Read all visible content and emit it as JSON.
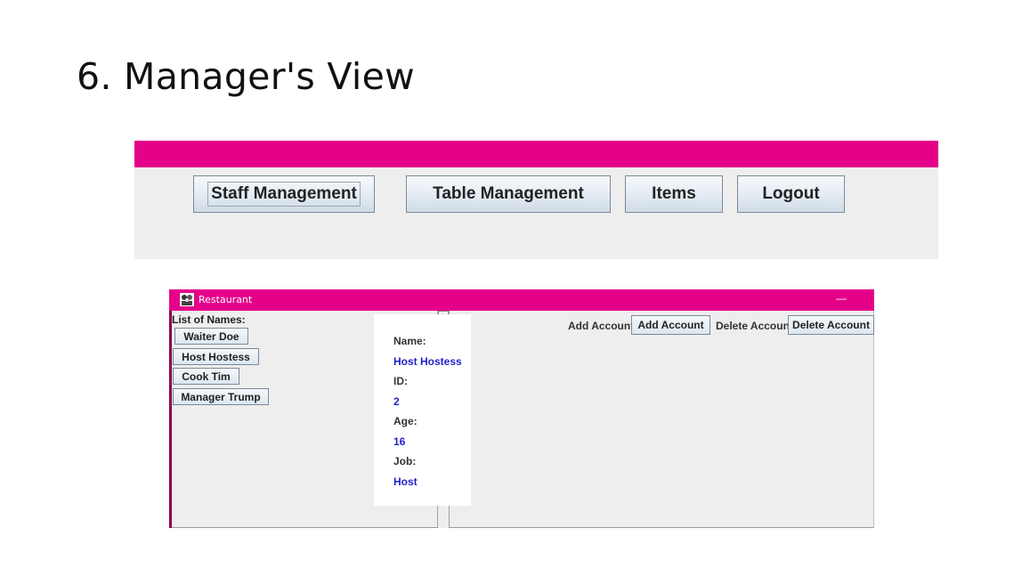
{
  "slide": {
    "title": "6.  Manager's View"
  },
  "colors": {
    "accent": "#e5008a",
    "value_text": "#1f1fc8"
  },
  "menu": {
    "buttons": [
      {
        "label": "Staff Management"
      },
      {
        "label": "Table Management"
      },
      {
        "label": "Items"
      },
      {
        "label": "Logout"
      }
    ]
  },
  "window": {
    "title": "Restaurant",
    "icon": "restaurant-app-icon",
    "minimize_glyph": "—"
  },
  "names_list": {
    "label": "List of Names:",
    "items": [
      "Waiter Doe",
      "Host Hostess",
      "Cook Tim",
      "Manager Trump"
    ]
  },
  "details": {
    "name_label": "Name:",
    "name_value": "Host Hostess",
    "id_label": "ID:",
    "id_value": "2",
    "age_label": "Age:",
    "age_value": "16",
    "job_label": "Job:",
    "job_value": "Host"
  },
  "accounts": {
    "add_label": "Add Account:",
    "add_button": "Add Account",
    "delete_label": "Delete Account:",
    "delete_button": "Delete Account"
  }
}
